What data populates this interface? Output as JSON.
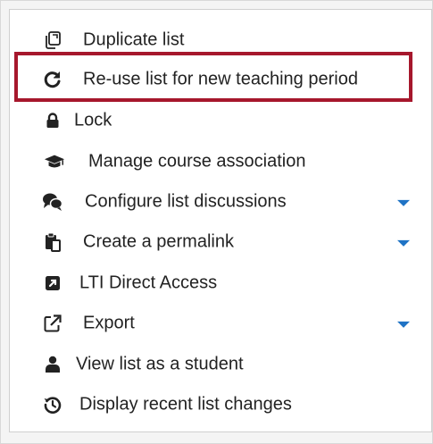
{
  "menu": {
    "items": [
      {
        "label": "Duplicate list",
        "icon": "copy-icon",
        "has_caret": false
      },
      {
        "label": "Re-use list for new teaching period",
        "icon": "refresh-icon",
        "has_caret": false
      },
      {
        "label": "Lock",
        "icon": "lock-icon",
        "has_caret": false
      },
      {
        "label": "Manage course association",
        "icon": "graduation-cap-icon",
        "has_caret": false
      },
      {
        "label": "Configure list discussions",
        "icon": "comments-icon",
        "has_caret": true
      },
      {
        "label": "Create a permalink",
        "icon": "paste-icon",
        "has_caret": true
      },
      {
        "label": "LTI Direct Access",
        "icon": "external-link-square-icon",
        "has_caret": false
      },
      {
        "label": "Export",
        "icon": "export-icon",
        "has_caret": true
      },
      {
        "label": "View list as a student",
        "icon": "user-icon",
        "has_caret": false
      },
      {
        "label": "Display recent list changes",
        "icon": "history-icon",
        "has_caret": false
      }
    ]
  },
  "colors": {
    "highlight_border": "#a6172c",
    "caret": "#1f73c5",
    "text": "#222222"
  }
}
